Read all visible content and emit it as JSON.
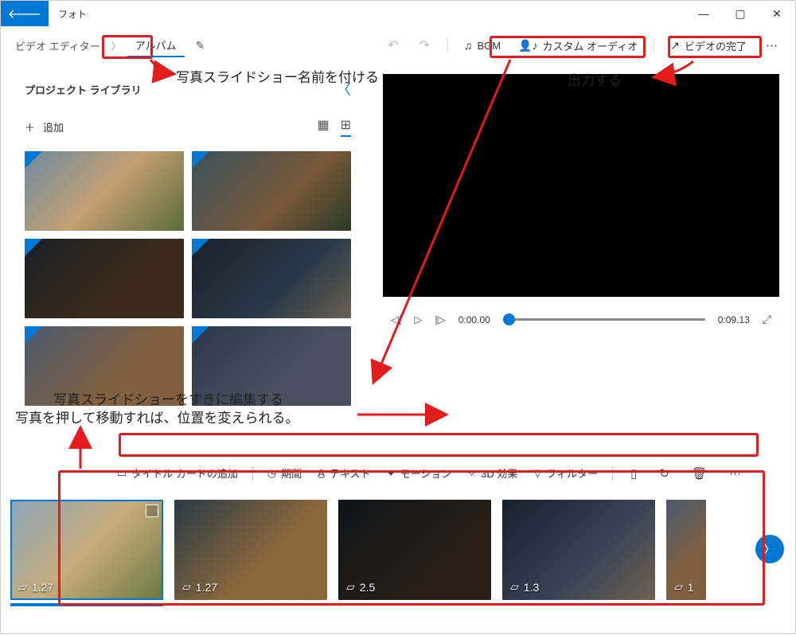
{
  "titlebar": {
    "app_name": "フォト"
  },
  "breadcrumb": {
    "video_editor": "ビデオ エディター",
    "album": "アルバム"
  },
  "toolbar": {
    "bgm": "BGM",
    "custom_audio": "カスタム オーディオ",
    "finish_video": "ビデオの完了"
  },
  "library": {
    "title": "プロジェクト ライブラリ",
    "add": "追加"
  },
  "playback": {
    "current": "0:00.00",
    "total": "0:09.13"
  },
  "clip_toolbar": {
    "title_card": "タイトル カードの追加",
    "duration": "期間",
    "text": "テキスト",
    "motion": "モーション",
    "effect3d": "3D 効果",
    "filter": "フィルター"
  },
  "clips": [
    {
      "duration": "1.27"
    },
    {
      "duration": "1.27"
    },
    {
      "duration": "2.5"
    },
    {
      "duration": "1.3"
    },
    {
      "duration": "1"
    }
  ],
  "annotations": {
    "name_slideshow": "写真スライドショー名前を付ける",
    "export": "出力する",
    "edit_slideshow1": "写真スライドショーをすきに編集する",
    "edit_slideshow2": "写真を押して移動すれば、位置を変えられる。"
  }
}
